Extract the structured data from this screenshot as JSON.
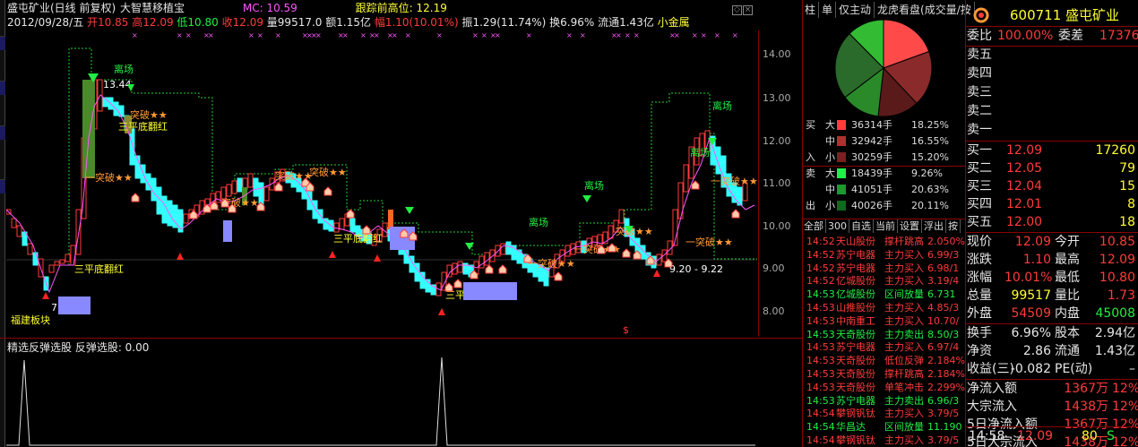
{
  "header": {
    "stock": "盛屯矿业(日线 前复权)",
    "indicator": "大智慧移植宝",
    "mc": "MC: 10.59",
    "track": "跟踪前高位: 12.19",
    "date": "2012/09/28/五",
    "open": "开10.85",
    "high": "高12.09",
    "low": "低10.80",
    "close": "收12.09",
    "vol": "量99517.0",
    "amount": "额1.15亿",
    "change": "幅1.10(10.01%)",
    "amplitude": "振1.29(11.74%)",
    "turnover": "换6.96%",
    "float": "流通1.43亿",
    "tag": "小金属"
  },
  "left_strip_labels": [
    "",
    "",
    "",
    ""
  ],
  "price_axis": [
    "14.00",
    "13.00",
    "12.00",
    "11.00",
    "10.00",
    "9.00",
    "8.00"
  ],
  "chart_labels": {
    "exit": "离场",
    "breakout": "突破★★",
    "breakout2": "一突破★★",
    "bottom_red": "三平底翻红",
    "high_val": "13.44",
    "low_val": "7.94",
    "range_text": "9.20 - 9.22",
    "region": "福建板块",
    "dollar": "$"
  },
  "sub_title": "精选反弹选股  反弹选股: 0.00",
  "rp_tabs": [
    "柱",
    "单",
    "仅主动",
    "龙虎看盘(成交量/按"
  ],
  "flow": [
    {
      "side": "买",
      "sz": "大",
      "color": "#ff3b3b",
      "vol": "36314手",
      "pct": "18.25%"
    },
    {
      "side": "",
      "sz": "中",
      "color": "#b03030",
      "vol": "32942手",
      "pct": "16.55%"
    },
    {
      "side": "入",
      "sz": "小",
      "color": "#7a2020",
      "vol": "30259手",
      "pct": "15.20%"
    },
    {
      "side": "卖",
      "sz": "大",
      "color": "#22ee44",
      "vol": "18439手",
      "pct": "9.26%"
    },
    {
      "side": "",
      "sz": "中",
      "color": "#1a9a30",
      "vol": "41051手",
      "pct": "20.63%"
    },
    {
      "side": "出",
      "sz": "小",
      "color": "#0f6a20",
      "vol": "40026手",
      "pct": "20.11%"
    }
  ],
  "trade_tabs": [
    "全部",
    "300",
    "自选",
    "当前",
    "设置",
    "浮出",
    "按"
  ],
  "trades": [
    {
      "t": "14:52",
      "s": "天山股份",
      "a": "撑杆跳高",
      "p": "2.050%",
      "c": "red"
    },
    {
      "t": "14:52",
      "s": "苏宁电器",
      "a": "主力买入",
      "p": "6.99/3",
      "c": "red"
    },
    {
      "t": "14:52",
      "s": "苏宁电器",
      "a": "主力买入",
      "p": "6.98/1",
      "c": "red"
    },
    {
      "t": "14:52",
      "s": "亿城股份",
      "a": "主力买入",
      "p": "3.19/4",
      "c": "red"
    },
    {
      "t": "14:53",
      "s": "亿城股份",
      "a": "区间放量",
      "p": "6.731",
      "c": "green"
    },
    {
      "t": "14:53",
      "s": "山推股份",
      "a": "主力买入",
      "p": "4.85/3",
      "c": "red"
    },
    {
      "t": "14:53",
      "s": "中南重工",
      "a": "主力买入",
      "p": "10.70/",
      "c": "red"
    },
    {
      "t": "14:53",
      "s": "天奇股份",
      "a": "主力卖出",
      "p": "8.50/3",
      "c": "green"
    },
    {
      "t": "14:53",
      "s": "苏宁电器",
      "a": "主力买入",
      "p": "6.97/4",
      "c": "red"
    },
    {
      "t": "14:53",
      "s": "天奇股份",
      "a": "低位反弹",
      "p": "2.184%",
      "c": "red"
    },
    {
      "t": "14:53",
      "s": "天奇股份",
      "a": "撑杆跳高",
      "p": "2.184%",
      "c": "red"
    },
    {
      "t": "14:53",
      "s": "天奇股份",
      "a": "单笔冲击",
      "p": "2.299%",
      "c": "red"
    },
    {
      "t": "14:53",
      "s": "苏宁电器",
      "a": "主力卖出",
      "p": "6.96/3",
      "c": "green"
    },
    {
      "t": "14:54",
      "s": "攀钢钒钛",
      "a": "主力买入",
      "p": "3.79/5",
      "c": "red"
    },
    {
      "t": "14:54",
      "s": "华昌达",
      "a": "区间放量",
      "p": "11.190",
      "c": "green"
    },
    {
      "t": "14:54",
      "s": "攀钢钒钛",
      "a": "主力买入",
      "p": "3.79/5",
      "c": "red"
    }
  ],
  "quote": {
    "code": "600711 盛屯矿业",
    "weibi_label": "委比",
    "weibi": "100.00%",
    "weicha_label": "委差",
    "weicha": "17376",
    "asks": [
      {
        "l": "卖五",
        "p": "",
        "v": ""
      },
      {
        "l": "卖四",
        "p": "",
        "v": ""
      },
      {
        "l": "卖三",
        "p": "",
        "v": ""
      },
      {
        "l": "卖二",
        "p": "",
        "v": ""
      },
      {
        "l": "卖一",
        "p": "",
        "v": ""
      }
    ],
    "bids": [
      {
        "l": "买一",
        "p": "12.09",
        "v": "17260"
      },
      {
        "l": "买二",
        "p": "12.05",
        "v": "79"
      },
      {
        "l": "买三",
        "p": "12.04",
        "v": "15"
      },
      {
        "l": "买四",
        "p": "12.01",
        "v": "8"
      },
      {
        "l": "买五",
        "p": "12.00",
        "v": "18"
      }
    ],
    "stats": [
      {
        "l1": "现价",
        "v1": "12.09",
        "c1": "red",
        "l2": "今开",
        "v2": "10.85",
        "c2": "red"
      },
      {
        "l1": "涨跌",
        "v1": "1.10",
        "c1": "red",
        "l2": "最高",
        "v2": "12.09",
        "c2": "red"
      },
      {
        "l1": "涨幅",
        "v1": "10.01%",
        "c1": "red",
        "l2": "最低",
        "v2": "10.80",
        "c2": "red"
      },
      {
        "l1": "总量",
        "v1": "99517",
        "c1": "yellow",
        "l2": "量比",
        "v2": "1.73",
        "c2": "red"
      },
      {
        "l1": "外盘",
        "v1": "54509",
        "c1": "red",
        "l2": "内盘",
        "v2": "45008",
        "c2": "green"
      }
    ],
    "stats2": [
      {
        "l1": "换手",
        "v1": "6.96%",
        "l2": "股本",
        "v2": "2.94亿"
      },
      {
        "l1": "净资",
        "v1": "2.86",
        "l2": "流通",
        "v2": "1.43亿"
      },
      {
        "l1": "收益(三)",
        "v1": "-0.082",
        "l2": "PE(动)",
        "v2": "–"
      }
    ],
    "flows": [
      {
        "l": "净流入额",
        "v": "1367万",
        "p": "12%"
      },
      {
        "l": "大宗流入",
        "v": "1438万",
        "p": "12%"
      },
      {
        "l": "5日净流入额",
        "v": "1367万",
        "p": "12%"
      },
      {
        "l": "5日大宗流入",
        "v": "1438万",
        "p": "12%"
      }
    ],
    "status_time": "14:58",
    "status_price": "12.09",
    "status_vol": "80",
    "status_flag": "S"
  },
  "colors": {
    "up": "#ff3b3b",
    "down": "#33ffff",
    "axis": "#8b0000",
    "ma": "#ff55ff"
  }
}
